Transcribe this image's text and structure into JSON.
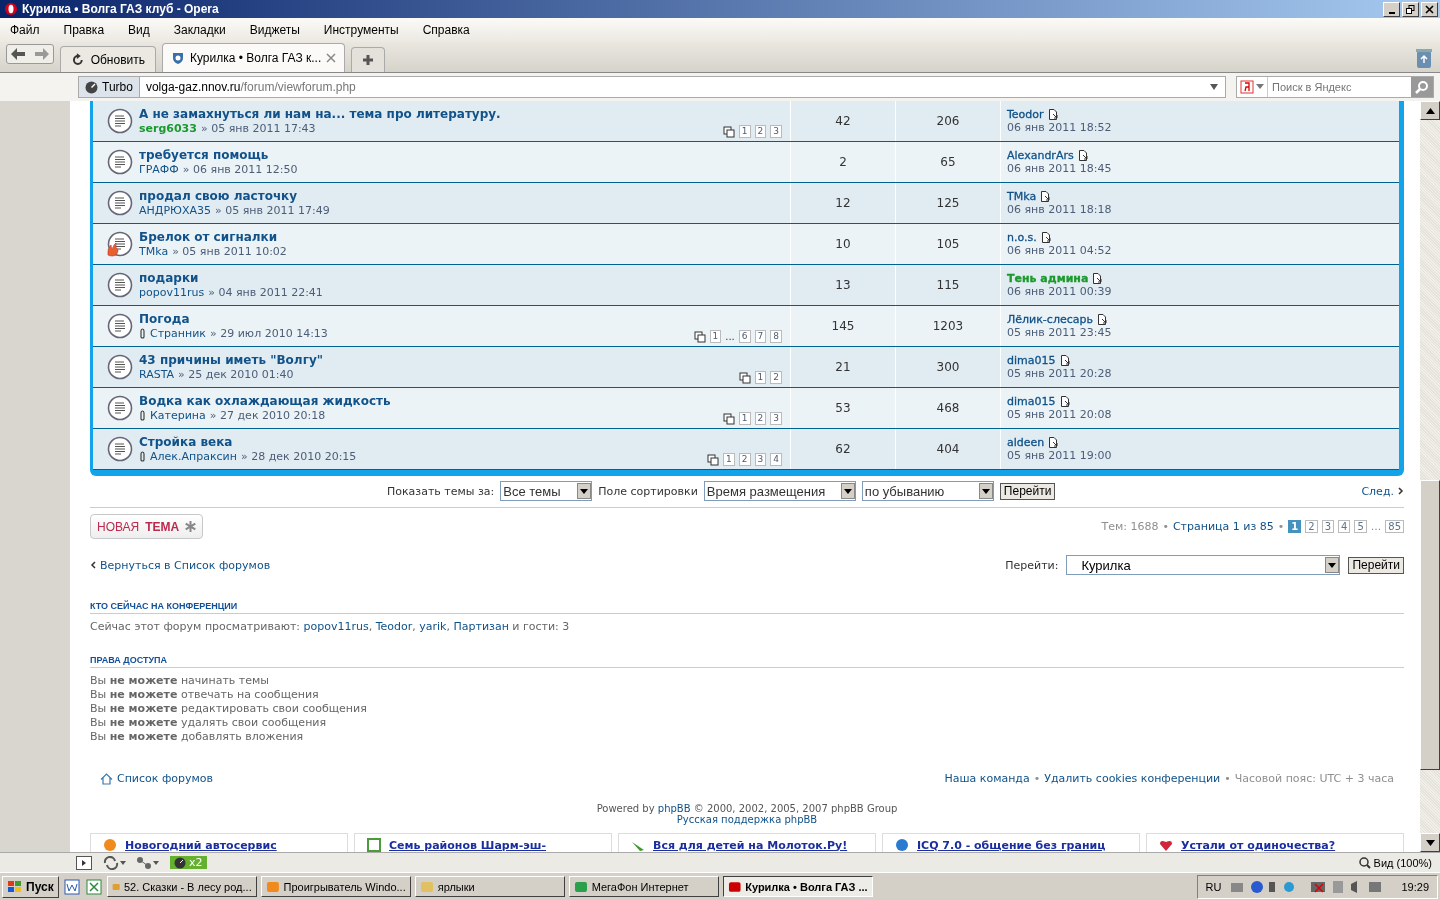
{
  "window": {
    "title": "Курилка • Волга ГАЗ клуб - Opera"
  },
  "menu": [
    "Файл",
    "Правка",
    "Вид",
    "Закладки",
    "Виджеты",
    "Инструменты",
    "Справка"
  ],
  "reload_button": "Обновить",
  "tabs": [
    {
      "label": "Курилка • Волга ГАЗ к...",
      "selected": true
    }
  ],
  "address": {
    "turbo": "Turbo",
    "host": "volga-gaz.nnov.ru",
    "path": "/forum/viewforum.php"
  },
  "search": {
    "placeholder": "Поиск в Яндекс"
  },
  "topics": [
    {
      "title": "А не замахнуться ли нам на... тема про литературу.",
      "author": {
        "name": "serg6033",
        "color": "#1a9a2c"
      },
      "date": "» 05 янв 2011 17:43",
      "attachment": false,
      "hot": false,
      "pages": [
        {
          "label": "1",
          "kind": "page"
        },
        {
          "label": "2",
          "kind": "page"
        },
        {
          "label": "3",
          "kind": "page"
        }
      ],
      "replies": "42",
      "views": "206",
      "last_post": {
        "author": {
          "name": "Teodor",
          "color": "#105289"
        },
        "date": "06 янв 2011 18:52"
      }
    },
    {
      "title": "требуется помощь",
      "author": {
        "name": "ГРАФФ",
        "color": "#105289"
      },
      "date": "» 06 янв 2011 12:50",
      "attachment": false,
      "hot": false,
      "replies": "2",
      "views": "65",
      "last_post": {
        "author": {
          "name": "AlexandrArs",
          "color": "#105289"
        },
        "date": "06 янв 2011 18:45"
      }
    },
    {
      "title": "продал свою ласточку",
      "author": {
        "name": "АНДРЮХА35",
        "color": "#105289"
      },
      "date": "» 05 янв 2011 17:49",
      "attachment": false,
      "hot": false,
      "replies": "12",
      "views": "125",
      "last_post": {
        "author": {
          "name": "TMka",
          "color": "#105289"
        },
        "date": "06 янв 2011 18:18"
      }
    },
    {
      "title": "Брелок от сигналки",
      "author": {
        "name": "TMka",
        "color": "#105289"
      },
      "date": "» 05 янв 2011 10:02",
      "attachment": false,
      "hot": true,
      "replies": "10",
      "views": "105",
      "last_post": {
        "author": {
          "name": "n.o.s.",
          "color": "#105289"
        },
        "date": "06 янв 2011 04:52"
      }
    },
    {
      "title": "подарки",
      "author": {
        "name": "popov11rus",
        "color": "#105289"
      },
      "date": "» 04 янв 2011 22:41",
      "attachment": false,
      "hot": false,
      "replies": "13",
      "views": "115",
      "last_post": {
        "author": {
          "name": "Тень админа",
          "color": "#1a9a2c"
        },
        "date": "06 янв 2011 00:39"
      }
    },
    {
      "title": "Погода",
      "author": {
        "name": "Странник",
        "color": "#105289"
      },
      "date": "» 29 июл 2010 14:13",
      "attachment": true,
      "hot": false,
      "pages": [
        {
          "label": "1",
          "kind": "page"
        },
        {
          "label": "...",
          "kind": "gap"
        },
        {
          "label": "6",
          "kind": "page"
        },
        {
          "label": "7",
          "kind": "page"
        },
        {
          "label": "8",
          "kind": "page"
        }
      ],
      "replies": "145",
      "views": "1203",
      "last_post": {
        "author": {
          "name": "Лёлик-слесарь",
          "color": "#105289"
        },
        "date": "05 янв 2011 23:45"
      }
    },
    {
      "title": "43 причины иметь \"Волгу\"",
      "author": {
        "name": "RASTA",
        "color": "#105289"
      },
      "date": "» 25 дек 2010 01:40",
      "attachment": false,
      "hot": false,
      "pages": [
        {
          "label": "1",
          "kind": "page"
        },
        {
          "label": "2",
          "kind": "page"
        }
      ],
      "replies": "21",
      "views": "300",
      "last_post": {
        "author": {
          "name": "dima015",
          "color": "#105289"
        },
        "date": "05 янв 2011 20:28"
      }
    },
    {
      "title": "Водка как охлаждающая жидкость",
      "author": {
        "name": "Катерина",
        "color": "#105289"
      },
      "date": "» 27 дек 2010 20:18",
      "attachment": true,
      "hot": false,
      "pages": [
        {
          "label": "1",
          "kind": "page"
        },
        {
          "label": "2",
          "kind": "page"
        },
        {
          "label": "3",
          "kind": "page"
        }
      ],
      "replies": "53",
      "views": "468",
      "last_post": {
        "author": {
          "name": "dima015",
          "color": "#105289"
        },
        "date": "05 янв 2011 20:08"
      }
    },
    {
      "title": "Стройка века",
      "author": {
        "name": "Алек.Апраксин",
        "color": "#105289"
      },
      "date": "» 28 дек 2010 20:15",
      "attachment": true,
      "hot": false,
      "pages": [
        {
          "label": "1",
          "kind": "page"
        },
        {
          "label": "2",
          "kind": "page"
        },
        {
          "label": "3",
          "kind": "page"
        },
        {
          "label": "4",
          "kind": "page"
        }
      ],
      "replies": "62",
      "views": "404",
      "last_post": {
        "author": {
          "name": "aldeen",
          "color": "#105289"
        },
        "date": "05 янв 2011 19:00"
      }
    }
  ],
  "sort_bar": {
    "show_label": "Показать темы за:",
    "show_value": "Все темы",
    "sort_label": "Поле сортировки",
    "sort_value": "Время размещения",
    "order_value": "по убыванию",
    "button": "Перейти",
    "next": "След."
  },
  "separator": "•",
  "new_topic_button": "НОВАЯ **ТЕМА**",
  "pagination": {
    "topics": "Тем: 1688",
    "page_of": "Страница 1 из 85",
    "pages": [
      {
        "label": "1",
        "kind": "page",
        "selected": true
      },
      {
        "label": "2",
        "kind": "page",
        "selected": false
      },
      {
        "label": "3",
        "kind": "page",
        "selected": false
      },
      {
        "label": "4",
        "kind": "page",
        "selected": false
      },
      {
        "label": "5",
        "kind": "page",
        "selected": false
      },
      {
        "label": "...",
        "kind": "gap",
        "selected": false
      },
      {
        "label": "85",
        "kind": "page",
        "selected": false
      }
    ]
  },
  "back_link": "Вернуться в Список форумов",
  "jump": {
    "label": "Перейти:",
    "value": "Курилка",
    "button": "Перейти"
  },
  "online": {
    "heading": "КТО СЕЙЧАС НА КОНФЕРЕНЦИИ",
    "prefix": "Сейчас этот форум просматривают:",
    "users": [
      "popov11rus",
      "Teodor",
      "yarik",
      "Партизан"
    ],
    "separator": ",",
    "suffix": "и гости: 3"
  },
  "permissions": {
    "heading": "ПРАВА ДОСТУПА",
    "lines": [
      "Вы **не можете** начинать темы",
      "Вы **не можете** отвечать на сообщения",
      "Вы **не можете** редактировать свои сообщения",
      "Вы **не можете** удалять свои сообщения",
      "Вы **не можете** добавлять вложения"
    ]
  },
  "footer": {
    "index_link": "Список форумов",
    "links": [
      "Наша команда",
      "Удалить cookies конференции"
    ],
    "timezone": "Часовой пояс: UTC + 3 часа",
    "powered_prefix": "Powered by",
    "powered_link": "phpBB",
    "powered_suffix": "© 2000, 2002, 2005, 2007 phpBB Group",
    "support_link": "Русская поддержка phpBB"
  },
  "ads": [
    "Новогодний автосервис",
    "Семь районов Шарм-эш-",
    "Вся для детей на Молоток.Ру!",
    "ICQ 7.0 - общение без границ",
    "Устали от одиночества?"
  ],
  "status_bar": {
    "turbo": "x2",
    "zoom": "Вид (100%)"
  },
  "taskbar": {
    "start": "Пуск",
    "tasks": [
      {
        "label": "52. Сказки - В лесу род...",
        "selected": false
      },
      {
        "label": "Проигрыватель Windo...",
        "selected": false
      },
      {
        "label": "ярлыки",
        "selected": false
      },
      {
        "label": "МегаФон Интернет",
        "selected": false
      },
      {
        "label": "Курилка • Волга ГАЗ ...",
        "selected": true
      }
    ],
    "language": "RU",
    "clock": "19:29"
  }
}
